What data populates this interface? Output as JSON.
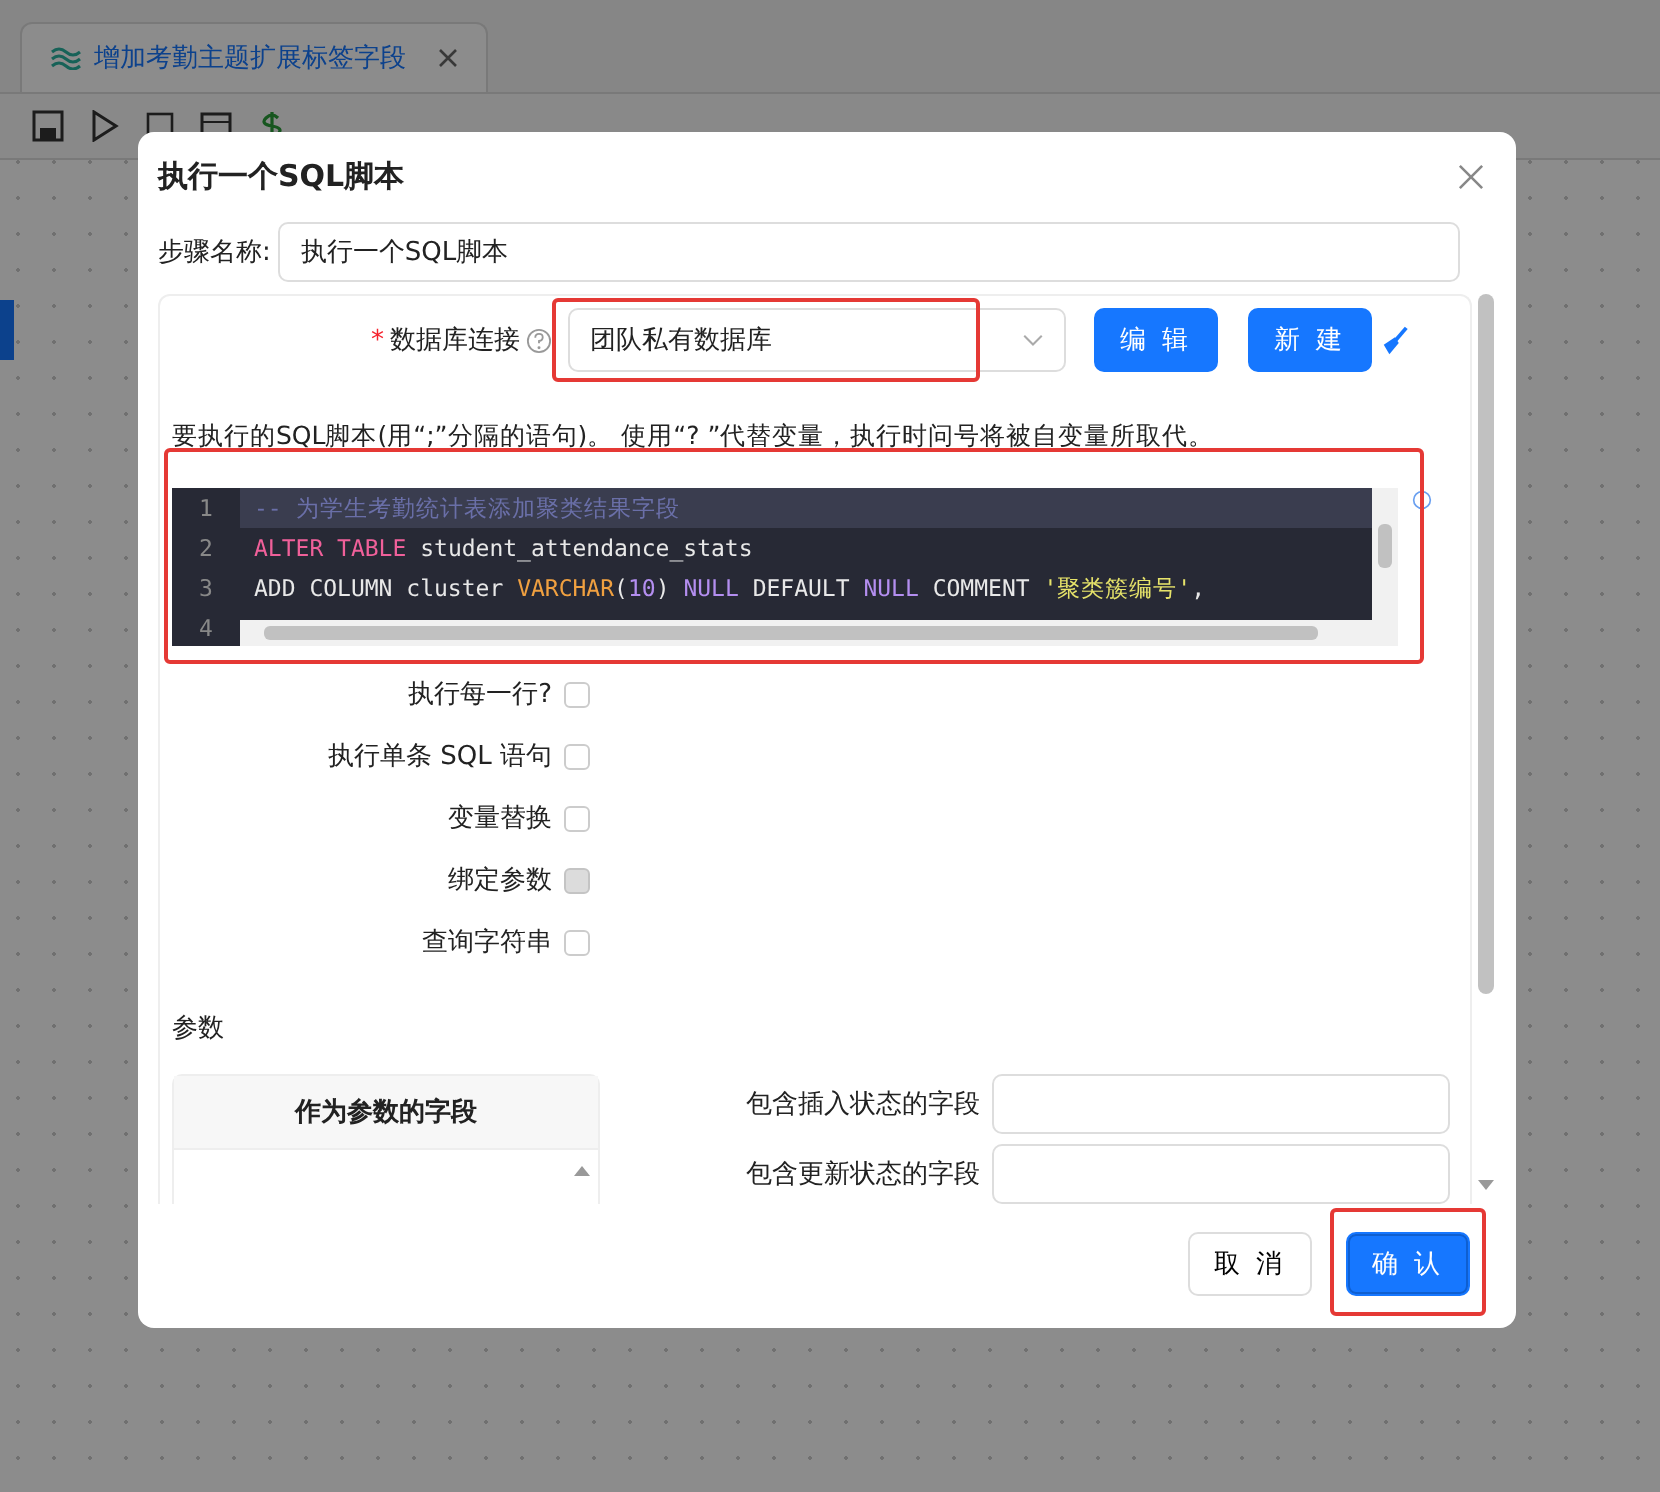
{
  "app": {
    "tab": {
      "label": "增加考勤主题扩展标签字段",
      "selected": true
    }
  },
  "dialog": {
    "title": "执行一个SQL脚本",
    "step_name": {
      "label": "步骤名称:",
      "value": "执行一个SQL脚本"
    },
    "connection": {
      "required_mark": "*",
      "label": "数据库连接",
      "value": "团队私有数据库",
      "highlighted": true,
      "buttons": [
        "编 辑",
        "新 建"
      ]
    },
    "script_hint": "要执行的SQL脚本(用“;”分隔的语句)。 使用“?  ”代替变量，执行时问号将被自变量所取代。",
    "script": {
      "highlighted": true,
      "lines": [
        {
          "number": "1",
          "selected": true,
          "tokens": [
            {
              "kind": "comment",
              "text": "-- 为学生考勤统计表添加聚类结果字段"
            }
          ]
        },
        {
          "number": "2",
          "selected": false,
          "tokens": [
            {
              "kind": "keyword",
              "text": "ALTER TABLE"
            },
            {
              "kind": "plain",
              "text": " student_attendance_stats"
            }
          ]
        },
        {
          "number": "3",
          "selected": false,
          "tokens": [
            {
              "kind": "plain",
              "text": "ADD COLUMN cluster "
            },
            {
              "kind": "type",
              "text": "VARCHAR"
            },
            {
              "kind": "plain",
              "text": "("
            },
            {
              "kind": "number",
              "text": "10"
            },
            {
              "kind": "plain",
              "text": ") "
            },
            {
              "kind": "null",
              "text": "NULL"
            },
            {
              "kind": "plain",
              "text": " DEFAULT "
            },
            {
              "kind": "null",
              "text": "NULL"
            },
            {
              "kind": "plain",
              "text": " COMMENT "
            },
            {
              "kind": "string",
              "text": "'聚类簇编号'"
            },
            {
              "kind": "plain",
              "text": ","
            }
          ]
        },
        {
          "number": "4",
          "selected": false
        }
      ]
    },
    "options": [
      {
        "label": "执行每一行?",
        "checked": false,
        "disabled": false
      },
      {
        "label": "执行单条 SQL 语句",
        "checked": false,
        "disabled": false
      },
      {
        "label": "变量替换",
        "checked": false,
        "disabled": false
      },
      {
        "label": "绑定参数",
        "checked": false,
        "disabled": true
      },
      {
        "label": "查询字符串",
        "checked": false,
        "disabled": false
      }
    ],
    "params_label": "参数",
    "params_table": {
      "columns": [
        "作为参数的字段"
      ]
    },
    "status_fields": [
      {
        "label": "包含插入状态的字段"
      },
      {
        "label": "包含更新状态的字段"
      }
    ],
    "buttons": [
      {
        "label": "取 消",
        "kind": "default",
        "highlighted": false
      },
      {
        "label": "确 认",
        "kind": "primary",
        "highlighted": true
      }
    ]
  }
}
